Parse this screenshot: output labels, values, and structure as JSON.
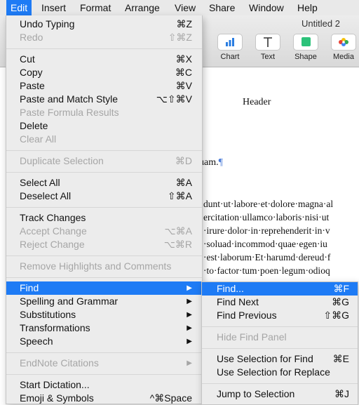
{
  "menubar": {
    "items": [
      "Edit",
      "Insert",
      "Format",
      "Arrange",
      "View",
      "Share",
      "Window",
      "Help"
    ]
  },
  "window": {
    "title": "Untitled 2",
    "toolbar": [
      {
        "label": "Chart",
        "icon": "chart-icon"
      },
      {
        "label": "Text",
        "icon": "text-icon"
      },
      {
        "label": "Shape",
        "icon": "shape-icon"
      },
      {
        "label": "Media",
        "icon": "media-icon"
      }
    ]
  },
  "document": {
    "header": "Header",
    "partial_line": "uam.",
    "pilcrow": "¶",
    "body_lines": [
      "dunt·ut·labore·et·dolore·magna·al",
      "ercitation·ullamco·laboris·nisi·ut",
      "·irure·dolor·in·reprehenderit·in·v",
      "·soluad·incommod·quae·egen·iu",
      "·est·laborum·Et·harumd·dereud·f",
      "·to·factor·tum·poen·legum·odioq"
    ]
  },
  "edit_menu": {
    "items": [
      {
        "label": "Undo Typing",
        "shortcut": "⌘Z",
        "disabled": false
      },
      {
        "label": "Redo",
        "shortcut": "⇧⌘Z",
        "disabled": true
      },
      {
        "label": "Cut",
        "shortcut": "⌘X",
        "disabled": false
      },
      {
        "label": "Copy",
        "shortcut": "⌘C",
        "disabled": false
      },
      {
        "label": "Paste",
        "shortcut": "⌘V",
        "disabled": false
      },
      {
        "label": "Paste and Match Style",
        "shortcut": "⌥⇧⌘V",
        "disabled": false
      },
      {
        "label": "Paste Formula Results",
        "shortcut": "",
        "disabled": true
      },
      {
        "label": "Delete",
        "shortcut": "",
        "disabled": false
      },
      {
        "label": "Clear All",
        "shortcut": "",
        "disabled": true
      },
      {
        "label": "Duplicate Selection",
        "shortcut": "⌘D",
        "disabled": true
      },
      {
        "label": "Select All",
        "shortcut": "⌘A",
        "disabled": false
      },
      {
        "label": "Deselect All",
        "shortcut": "⇧⌘A",
        "disabled": false
      },
      {
        "label": "Track Changes",
        "shortcut": "",
        "disabled": false
      },
      {
        "label": "Accept Change",
        "shortcut": "⌥⌘A",
        "disabled": true
      },
      {
        "label": "Reject Change",
        "shortcut": "⌥⌘R",
        "disabled": true
      },
      {
        "label": "Remove Highlights and Comments",
        "shortcut": "",
        "disabled": true
      },
      {
        "label": "Find",
        "shortcut": "",
        "disabled": false,
        "submenu": true,
        "highlighted": true
      },
      {
        "label": "Spelling and Grammar",
        "shortcut": "",
        "disabled": false,
        "submenu": true
      },
      {
        "label": "Substitutions",
        "shortcut": "",
        "disabled": false,
        "submenu": true
      },
      {
        "label": "Transformations",
        "shortcut": "",
        "disabled": false,
        "submenu": true
      },
      {
        "label": "Speech",
        "shortcut": "",
        "disabled": false,
        "submenu": true
      },
      {
        "label": "EndNote Citations",
        "shortcut": "",
        "disabled": true,
        "submenu": true
      },
      {
        "label": "Start Dictation...",
        "shortcut": "",
        "disabled": false
      },
      {
        "label": "Emoji & Symbols",
        "shortcut": "^⌘Space",
        "disabled": false
      }
    ]
  },
  "find_submenu": {
    "items": [
      {
        "label": "Find...",
        "shortcut": "⌘F",
        "disabled": false,
        "highlighted": true
      },
      {
        "label": "Find Next",
        "shortcut": "⌘G",
        "disabled": false
      },
      {
        "label": "Find Previous",
        "shortcut": "⇧⌘G",
        "disabled": false
      },
      {
        "label": "Hide Find Panel",
        "shortcut": "",
        "disabled": true
      },
      {
        "label": "Use Selection for Find",
        "shortcut": "⌘E",
        "disabled": false
      },
      {
        "label": "Use Selection for Replace",
        "shortcut": "",
        "disabled": false
      },
      {
        "label": "Jump to Selection",
        "shortcut": "⌘J",
        "disabled": false
      }
    ]
  },
  "colors": {
    "highlight": "#1e7bf5",
    "disabled_text": "#a6a6a6"
  }
}
